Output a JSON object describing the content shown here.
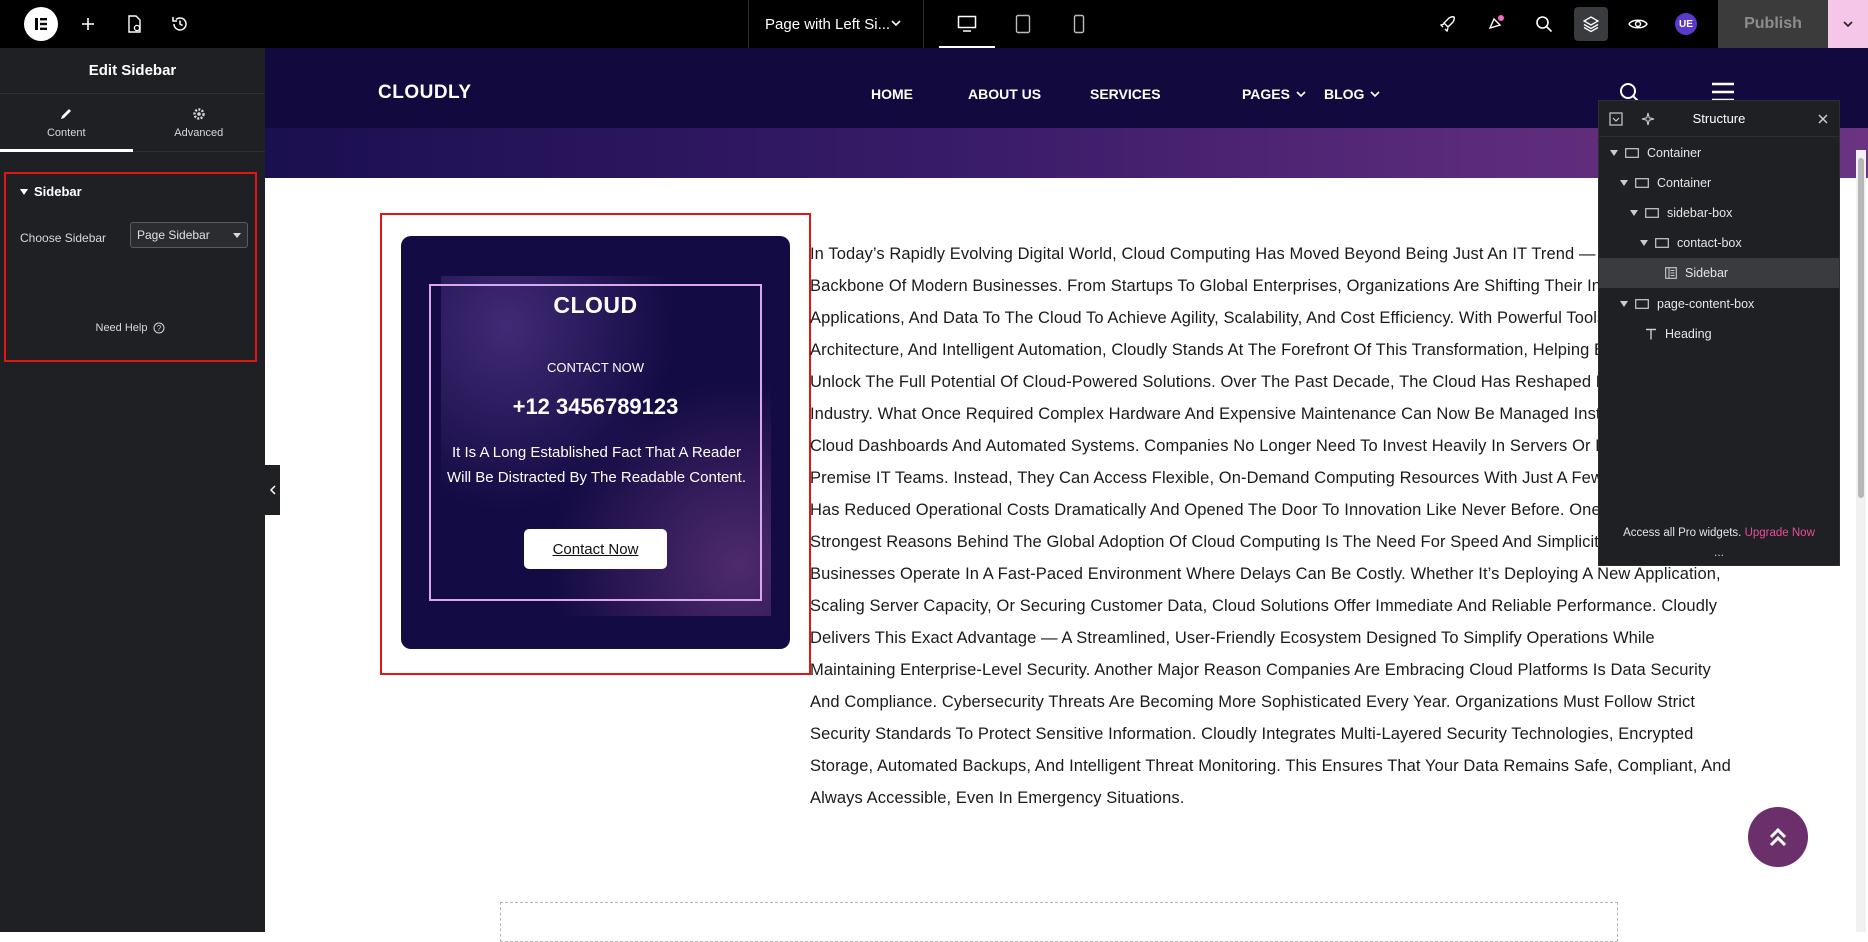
{
  "topbar": {
    "page_name": "Page with Left Si...",
    "publish_label": "Publish",
    "user_initials": "UE"
  },
  "panel": {
    "title": "Edit Sidebar",
    "tabs": [
      {
        "label": "Content",
        "icon": "pencil-icon"
      },
      {
        "label": "Advanced",
        "icon": "gear-icon"
      }
    ],
    "section_title": "Sidebar",
    "choose_label": "Choose Sidebar",
    "choose_value": "Page Sidebar",
    "need_help": "Need Help"
  },
  "site": {
    "brand": "CLOUDLY",
    "nav": [
      "HOME",
      "ABOUT US",
      "SERVICES",
      "PAGES",
      "BLOG"
    ],
    "card": {
      "title": "CLOUD",
      "subtitle": "CONTACT NOW",
      "phone": "+12 3456789123",
      "text": "It Is A Long Established Fact That A Reader Will Be Distracted By The Readable Content.",
      "button": "Contact Now"
    },
    "body_text": "In Today’s Rapidly Evolving Digital World, Cloud Computing Has Moved Beyond Being Just An IT Trend — It Is Now The Backbone Of Modern Businesses. From Startups To Global Enterprises, Organizations Are Shifting Their Infrastructure, Applications, And Data To The Cloud To Achieve Agility, Scalability, And Cost Efficiency. With Powerful Tools, Secure Architecture, And Intelligent Automation, Cloudly Stands At The Forefront Of This Transformation, Helping Businesses Unlock The Full Potential Of Cloud-Powered Solutions. Over The Past Decade, The Cloud Has Reshaped Nearly Every Industry. What Once Required Complex Hardware And Expensive Maintenance Can Now Be Managed Instantly Through Cloud Dashboards And Automated Systems. Companies No Longer Need To Invest Heavily In Servers Or Manage On-Premise IT Teams. Instead, They Can Access Flexible, On-Demand Computing Resources With Just A Few Clicks. This Shift Has Reduced Operational Costs Dramatically And Opened The Door To Innovation Like Never Before. One Of The Strongest Reasons Behind The Global Adoption Of Cloud Computing Is The Need For Speed And Simplicity. Today’s Businesses Operate In A Fast-Paced Environment Where Delays Can Be Costly. Whether It’s Deploying A New Application, Scaling Server Capacity, Or Securing Customer Data, Cloud Solutions Offer Immediate And Reliable Performance. Cloudly Delivers This Exact Advantage — A Streamlined, User-Friendly Ecosystem Designed To Simplify Operations While Maintaining Enterprise-Level Security. Another Major Reason Companies Are Embracing Cloud Platforms Is Data Security And Compliance. Cybersecurity Threats Are Becoming More Sophisticated Every Year. Organizations Must Follow Strict Security Standards To Protect Sensitive Information. Cloudly Integrates Multi-Layered Security Technologies, Encrypted Storage, Automated Backups, And Intelligent Threat Monitoring. This Ensures That Your Data Remains Safe, Compliant, And Always Accessible, Even In Emergency Situations."
  },
  "structure": {
    "title": "Structure",
    "items": [
      {
        "label": "Container",
        "icon": "container-icon"
      },
      {
        "label": "Container",
        "icon": "container-icon"
      },
      {
        "label": "sidebar-box",
        "icon": "container-icon"
      },
      {
        "label": "contact-box",
        "icon": "container-icon"
      },
      {
        "label": "Sidebar",
        "icon": "sidebar-widget-icon"
      },
      {
        "label": "page-content-box",
        "icon": "container-icon"
      },
      {
        "label": "Heading",
        "icon": "heading-icon"
      }
    ],
    "footer_text": "Access all Pro widgets.",
    "footer_link": "Upgrade Now",
    "more": "..."
  },
  "colors": {
    "header_bg": "#120a3f",
    "card_bg": "#130b43",
    "accent_pink": "#e84d9b",
    "selection_red": "#e01515",
    "scroll_button": "#6b2f6b"
  }
}
